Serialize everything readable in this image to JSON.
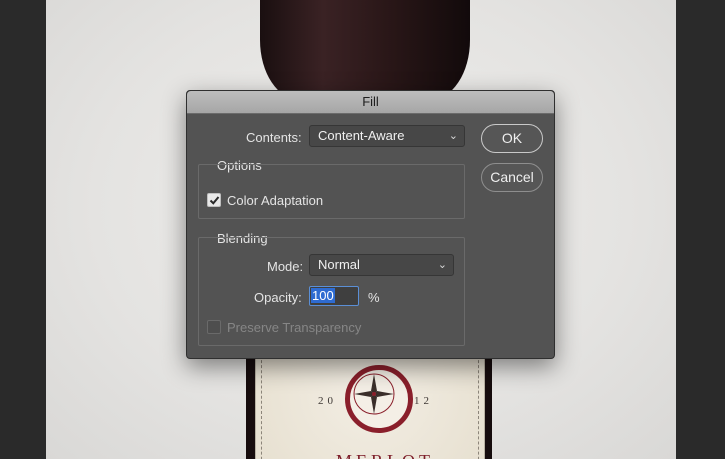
{
  "dialog": {
    "title": "Fill",
    "contents_label": "Contents:",
    "contents_value": "Content-Aware",
    "ok_label": "OK",
    "cancel_label": "Cancel",
    "options_label": "Options",
    "color_adaptation_label": "Color Adaptation",
    "color_adaptation_checked": true,
    "blending_label": "Blending",
    "mode_label": "Mode:",
    "mode_value": "Normal",
    "opacity_label": "Opacity:",
    "opacity_value": "100",
    "opacity_unit": "%",
    "preserve_transparency_label": "Preserve Transparency",
    "preserve_transparency_checked": false,
    "preserve_transparency_enabled": false
  },
  "canvas": {
    "year_left": "20",
    "year_right": "12",
    "wine_name": "MERLOT"
  },
  "icons": {
    "dropdown": "chevron-down-icon",
    "check": "checkmark-icon"
  },
  "colors": {
    "dialog_bg": "#535353",
    "selection": "#2e6bd1",
    "label_accent": "#8a1f2b"
  }
}
